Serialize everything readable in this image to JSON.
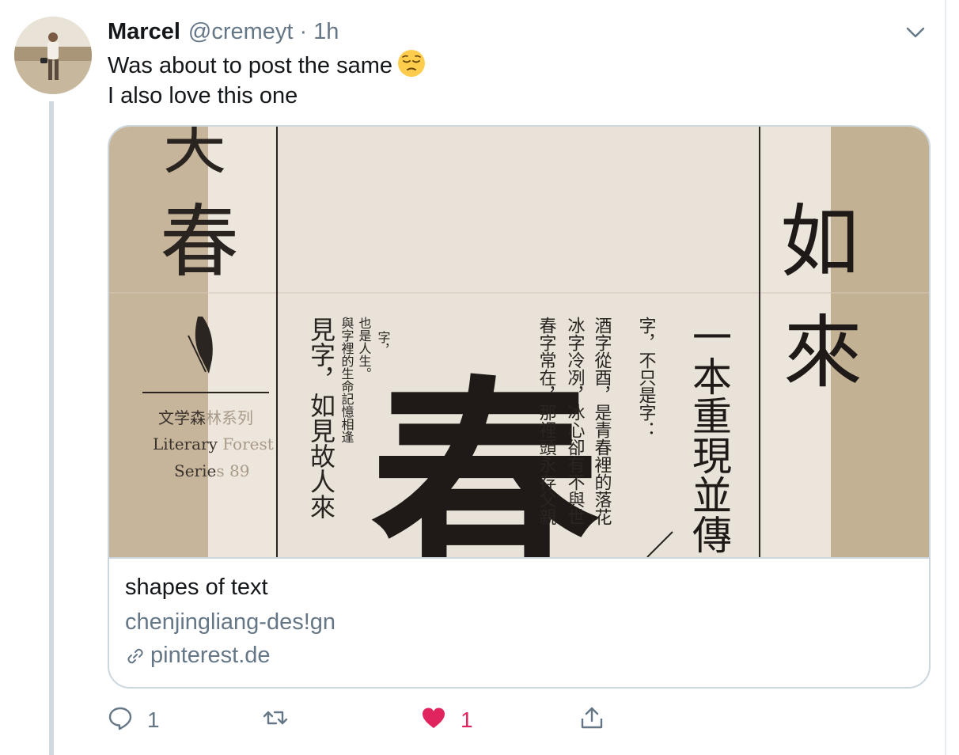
{
  "tweet": {
    "author_name": "Marcel",
    "handle": "@cremeyt",
    "separator": "·",
    "time": "1h",
    "text_line1": "Was about to post the same",
    "text_line2": "I also love this one",
    "emoji": "pensive-face"
  },
  "card": {
    "title": "shapes of text",
    "description": "chenjingliang-des!gn",
    "domain": "pinterest.de",
    "image_text": {
      "left_top": "天",
      "left_big": "春",
      "series_cn_a": "文学森",
      "series_cn_b": "林系列",
      "series_en1_a": "Literary",
      "series_en1_b": " Forest",
      "series_en2_a": "Serie",
      "series_en2_b": "s 89",
      "col_a": "見字，如見故人來",
      "col_b": "與字裡的生命記憶相逢",
      "col_c": "也是人生。",
      "col_d": "字，",
      "big_glyph": "春",
      "col_e": "春字常在，那裡頭永存父親",
      "col_f": "冰字冷冽，冰心卻有不與世",
      "col_g": "酒字從酉，是青春裡的落花",
      "col_h": "字，不只是字：",
      "col_i": "一本重現並傳",
      "right_a": "如",
      "right_b": "來"
    }
  },
  "actions": {
    "reply_count": "1",
    "retweet_count": "",
    "like_count": "1",
    "share_count": ""
  },
  "colors": {
    "text": "#14171a",
    "secondary": "#657786",
    "like": "#e0245e",
    "border": "#ccd6dd"
  }
}
